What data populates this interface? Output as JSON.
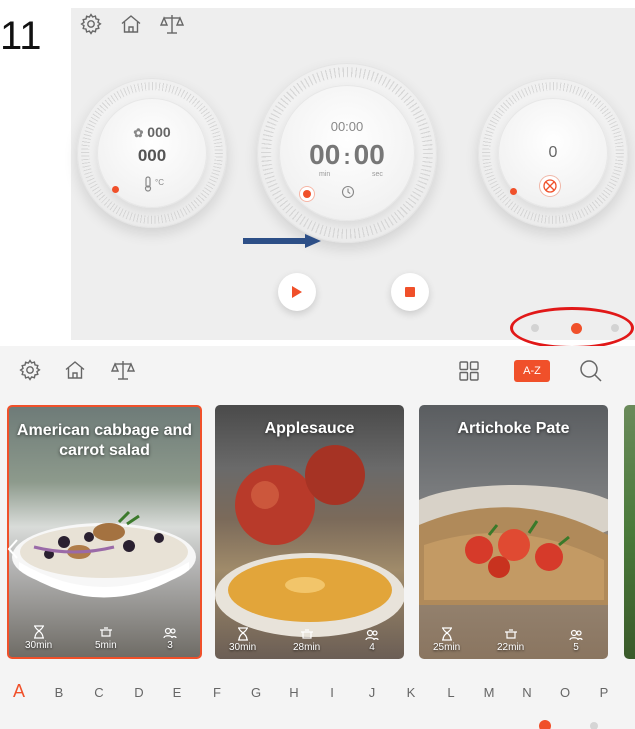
{
  "step_label": "11",
  "top_screen": {
    "toolbar": {
      "icons": [
        "gear-icon",
        "home-icon",
        "scale-icon"
      ]
    },
    "dial_left": {
      "top_value": "000",
      "main_value": "000",
      "unit": "°C"
    },
    "dial_center": {
      "time_small": "00:00",
      "minutes": "00",
      "separator": ":",
      "seconds": "00",
      "min_label": "min",
      "sec_label": "sec"
    },
    "dial_right": {
      "value": "0"
    },
    "page_dots": {
      "count": 3,
      "active_index": 1
    },
    "colors": {
      "accent": "#f0502a",
      "arrow": "#2d4f87",
      "highlight": "#e11818"
    }
  },
  "recipe_screen": {
    "az_label": "A-Z",
    "cards": [
      {
        "title": "American cabbage and carrot salad",
        "prep": "30min",
        "cook": "5min",
        "servings": "3",
        "selected": true
      },
      {
        "title": "Applesauce",
        "prep": "30min",
        "cook": "28min",
        "servings": "4",
        "selected": false
      },
      {
        "title": "Artichoke Pate",
        "prep": "25min",
        "cook": "22min",
        "servings": "5",
        "selected": false
      }
    ],
    "alphabet": [
      "A",
      "B",
      "C",
      "D",
      "E",
      "F",
      "G",
      "H",
      "I",
      "J",
      "K",
      "L",
      "M",
      "N",
      "O",
      "P"
    ],
    "active_letter": "A",
    "page_dots": {
      "count": 2,
      "active_index": 0
    }
  }
}
